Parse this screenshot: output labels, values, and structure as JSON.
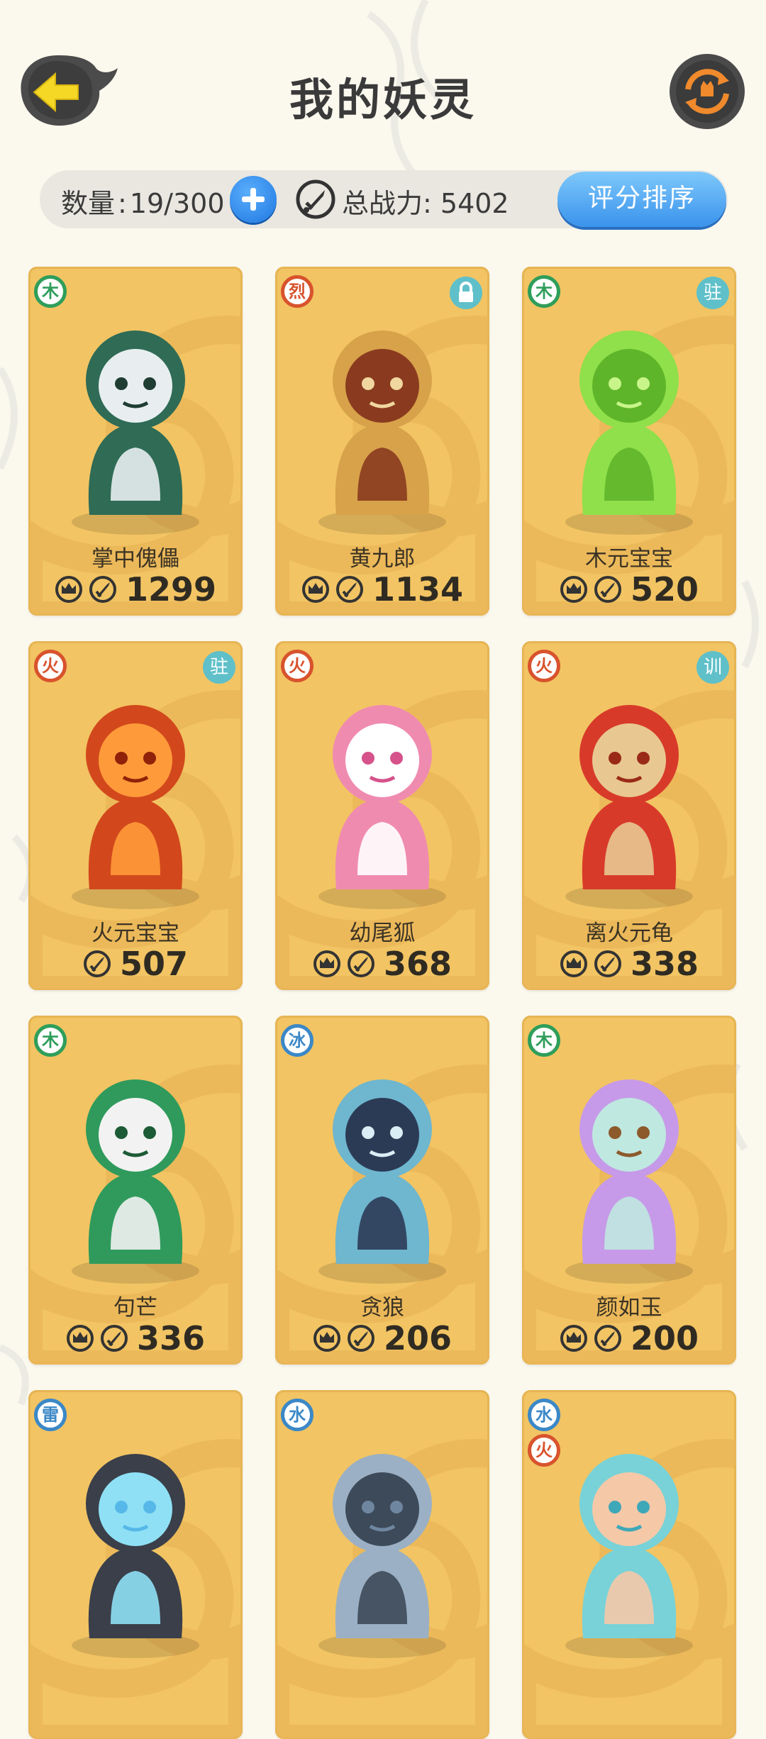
{
  "header": {
    "title": "我的妖灵",
    "back_icon": "back-arrow-icon",
    "switch_icon": "refresh-swap-icon"
  },
  "stats": {
    "count_label": "数量",
    "count_value": "19/300",
    "power_label": "总战力",
    "power_value": "5402",
    "sort_label": "评分排序"
  },
  "colors": {
    "card": "#f2c463",
    "wood": "#2f9e5a",
    "fire": "#d8532d",
    "ice": "#3b88c7",
    "water": "#3b88c7",
    "thunder": "#3b88c7",
    "fierce": "#d8532d",
    "badge": "#5fc0c9",
    "accent": "#3a93ec"
  },
  "cards": [
    {
      "name": "掌中傀儡",
      "power": "1299",
      "elements": [
        "木"
      ],
      "badge": "",
      "locked": false,
      "crown": true
    },
    {
      "name": "黄九郎",
      "power": "1134",
      "elements": [
        "烈"
      ],
      "badge": "",
      "locked": true,
      "crown": true
    },
    {
      "name": "木元宝宝",
      "power": "520",
      "elements": [
        "木"
      ],
      "badge": "驻",
      "locked": false,
      "crown": true
    },
    {
      "name": "火元宝宝",
      "power": "507",
      "elements": [
        "火"
      ],
      "badge": "驻",
      "locked": false,
      "crown": false
    },
    {
      "name": "幼尾狐",
      "power": "368",
      "elements": [
        "火"
      ],
      "badge": "",
      "locked": false,
      "crown": true
    },
    {
      "name": "离火元龟",
      "power": "338",
      "elements": [
        "火"
      ],
      "badge": "训",
      "locked": false,
      "crown": true
    },
    {
      "name": "句芒",
      "power": "336",
      "elements": [
        "木"
      ],
      "badge": "",
      "locked": false,
      "crown": true
    },
    {
      "name": "贪狼",
      "power": "206",
      "elements": [
        "冰"
      ],
      "badge": "",
      "locked": false,
      "crown": true
    },
    {
      "name": "颜如玉",
      "power": "200",
      "elements": [
        "木"
      ],
      "badge": "",
      "locked": false,
      "crown": true
    },
    {
      "name": "",
      "power": "",
      "elements": [
        "雷"
      ],
      "badge": "",
      "locked": false,
      "crown": false
    },
    {
      "name": "",
      "power": "",
      "elements": [
        "水"
      ],
      "badge": "",
      "locked": false,
      "crown": false
    },
    {
      "name": "",
      "power": "",
      "elements": [
        "水",
        "火"
      ],
      "badge": "",
      "locked": false,
      "crown": false
    }
  ]
}
